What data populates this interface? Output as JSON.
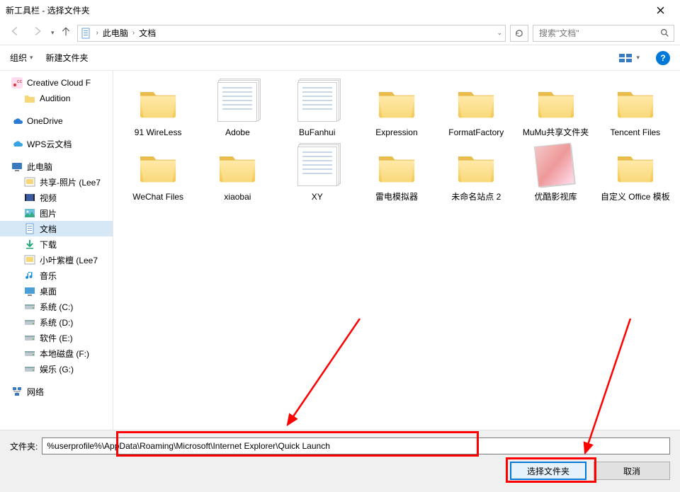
{
  "window": {
    "title": "新工具栏 - 选择文件夹"
  },
  "nav": {
    "crumbs": [
      "此电脑",
      "文档"
    ],
    "search_placeholder": "搜索\"文档\""
  },
  "toolbar": {
    "organize": "组织",
    "new_folder": "新建文件夹"
  },
  "sidebar": {
    "items": [
      {
        "label": "Creative Cloud F",
        "level": 1,
        "icon": "cc"
      },
      {
        "label": "Audition",
        "level": 2,
        "icon": "folder"
      },
      {
        "label": "OneDrive",
        "level": 1,
        "icon": "onedrive"
      },
      {
        "label": "WPS云文档",
        "level": 1,
        "icon": "wps"
      },
      {
        "label": "此电脑",
        "level": 1,
        "icon": "pc"
      },
      {
        "label": "共享-照片 (Lee7",
        "level": 2,
        "icon": "photo"
      },
      {
        "label": "视频",
        "level": 2,
        "icon": "video"
      },
      {
        "label": "图片",
        "level": 2,
        "icon": "picture"
      },
      {
        "label": "文档",
        "level": 2,
        "icon": "doc",
        "selected": true
      },
      {
        "label": "下载",
        "level": 2,
        "icon": "download"
      },
      {
        "label": "小叶紫檀 (Lee7",
        "level": 2,
        "icon": "photo"
      },
      {
        "label": "音乐",
        "level": 2,
        "icon": "music"
      },
      {
        "label": "桌面",
        "level": 2,
        "icon": "desktop"
      },
      {
        "label": "系统 (C:)",
        "level": 2,
        "icon": "drive"
      },
      {
        "label": "系统 (D:)",
        "level": 2,
        "icon": "drive"
      },
      {
        "label": "软件 (E:)",
        "level": 2,
        "icon": "drive"
      },
      {
        "label": "本地磁盘 (F:)",
        "level": 2,
        "icon": "drive"
      },
      {
        "label": "娱乐 (G:)",
        "level": 2,
        "icon": "drive"
      },
      {
        "label": "网络",
        "level": 1,
        "icon": "network"
      }
    ]
  },
  "content": {
    "items": [
      {
        "name": "91 WireLess",
        "kind": "folder"
      },
      {
        "name": "Adobe",
        "kind": "docstack"
      },
      {
        "name": "BuFanhui",
        "kind": "docstack"
      },
      {
        "name": "Expression",
        "kind": "folder"
      },
      {
        "name": "FormatFactory",
        "kind": "folder"
      },
      {
        "name": "MuMu共享文件夹",
        "kind": "folder"
      },
      {
        "name": "Tencent Files",
        "kind": "folder"
      },
      {
        "name": "WeChat Files",
        "kind": "folder"
      },
      {
        "name": "xiaobai",
        "kind": "folder"
      },
      {
        "name": "XY",
        "kind": "docstack"
      },
      {
        "name": "雷电模拟器",
        "kind": "folder"
      },
      {
        "name": "未命名站点 2",
        "kind": "folder"
      },
      {
        "name": "优酷影视库",
        "kind": "photostack"
      },
      {
        "name": "自定义 Office 模板",
        "kind": "folder"
      }
    ]
  },
  "bottom": {
    "label": "文件夹:",
    "value": "%userprofile%\\AppData\\Roaming\\Microsoft\\Internet Explorer\\Quick Launch",
    "select_btn": "选择文件夹",
    "cancel_btn": "取消"
  }
}
